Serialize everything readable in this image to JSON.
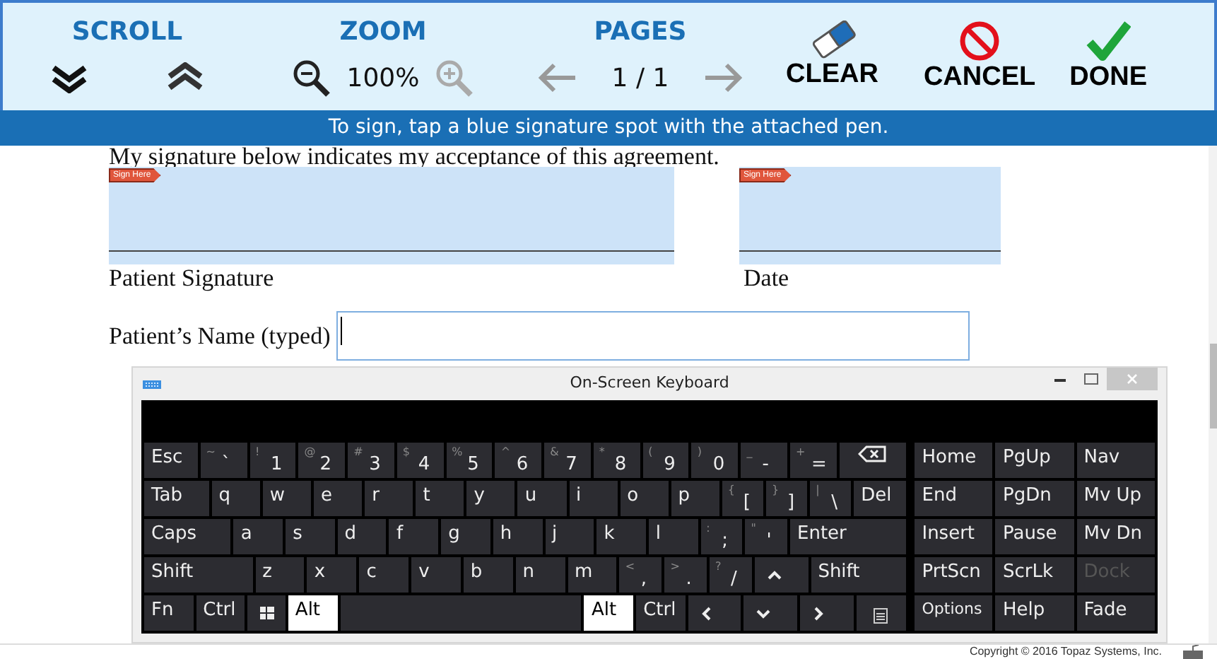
{
  "toolbar": {
    "scroll": {
      "title": "SCROLL"
    },
    "zoom": {
      "title": "ZOOM",
      "level_text": "100%",
      "zoom_out_disabled": false,
      "zoom_in_disabled": true
    },
    "pages": {
      "title": "PAGES",
      "page_text": "1 / 1",
      "prev_disabled": true,
      "next_disabled": true
    },
    "actions": [
      {
        "kind": "clear",
        "label": "CLEAR"
      },
      {
        "kind": "cancel",
        "label": "CANCEL"
      },
      {
        "kind": "done",
        "label": "DONE"
      }
    ]
  },
  "instruction": "To sign, tap a blue signature spot with the attached pen.",
  "document": {
    "agreement_text": "My signature below indicates my acceptance of this agreement.",
    "signature_spots": [
      {
        "tag": "Sign Here",
        "caption": "Patient Signature"
      },
      {
        "tag": "Sign Here",
        "caption": "Date"
      }
    ],
    "name_field": {
      "label": "Patient’s Name (typed)",
      "focused": true
    }
  },
  "keyboard": {
    "title": "On-Screen Keyboard",
    "main_rows": [
      [
        {
          "kind": "text",
          "label": "Esc",
          "pressed": false
        },
        {
          "kind": "dual",
          "shift": "~",
          "label": "`",
          "pressed": false
        },
        {
          "kind": "dual",
          "shift": "!",
          "label": "1",
          "pressed": false
        },
        {
          "kind": "dual",
          "shift": "@",
          "label": "2",
          "pressed": false
        },
        {
          "kind": "dual",
          "shift": "#",
          "label": "3",
          "pressed": false
        },
        {
          "kind": "dual",
          "shift": "$",
          "label": "4",
          "pressed": false
        },
        {
          "kind": "dual",
          "shift": "%",
          "label": "5",
          "pressed": false
        },
        {
          "kind": "dual",
          "shift": "^",
          "label": "6",
          "pressed": false
        },
        {
          "kind": "dual",
          "shift": "&",
          "label": "7",
          "pressed": false
        },
        {
          "kind": "dual",
          "shift": "*",
          "label": "8",
          "pressed": false
        },
        {
          "kind": "dual",
          "shift": "(",
          "label": "9",
          "pressed": false
        },
        {
          "kind": "dual",
          "shift": ")",
          "label": "0",
          "pressed": false
        },
        {
          "kind": "dual",
          "shift": "_",
          "label": "-",
          "pressed": false
        },
        {
          "kind": "dual",
          "shift": "+",
          "label": "=",
          "pressed": false
        },
        {
          "kind": "backspace",
          "pressed": false
        }
      ],
      [
        {
          "kind": "text",
          "label": "Tab",
          "pressed": false
        },
        {
          "kind": "text",
          "label": "q",
          "pressed": false
        },
        {
          "kind": "text",
          "label": "w",
          "pressed": false
        },
        {
          "kind": "text",
          "label": "e",
          "pressed": false
        },
        {
          "kind": "text",
          "label": "r",
          "pressed": false
        },
        {
          "kind": "text",
          "label": "t",
          "pressed": false
        },
        {
          "kind": "text",
          "label": "y",
          "pressed": false
        },
        {
          "kind": "text",
          "label": "u",
          "pressed": false
        },
        {
          "kind": "text",
          "label": "i",
          "pressed": false
        },
        {
          "kind": "text",
          "label": "o",
          "pressed": false
        },
        {
          "kind": "text",
          "label": "p",
          "pressed": false
        },
        {
          "kind": "dual",
          "shift": "{",
          "label": "[",
          "pressed": false
        },
        {
          "kind": "dual",
          "shift": "}",
          "label": "]",
          "pressed": false
        },
        {
          "kind": "dual",
          "shift": "|",
          "label": "\\",
          "pressed": false
        },
        {
          "kind": "text",
          "label": "Del",
          "pressed": false
        }
      ],
      [
        {
          "kind": "text",
          "label": "Caps",
          "pressed": false
        },
        {
          "kind": "text",
          "label": "a",
          "pressed": false
        },
        {
          "kind": "text",
          "label": "s",
          "pressed": false
        },
        {
          "kind": "text",
          "label": "d",
          "pressed": false
        },
        {
          "kind": "text",
          "label": "f",
          "pressed": false
        },
        {
          "kind": "text",
          "label": "g",
          "pressed": false
        },
        {
          "kind": "text",
          "label": "h",
          "pressed": false
        },
        {
          "kind": "text",
          "label": "j",
          "pressed": false
        },
        {
          "kind": "text",
          "label": "k",
          "pressed": false
        },
        {
          "kind": "text",
          "label": "l",
          "pressed": false
        },
        {
          "kind": "dual",
          "shift": ":",
          "label": ";",
          "pressed": false
        },
        {
          "kind": "dual",
          "shift": "\"",
          "label": "'",
          "pressed": false
        },
        {
          "kind": "text",
          "label": "Enter",
          "pressed": false
        }
      ],
      [
        {
          "kind": "text",
          "label": "Shift",
          "pressed": false
        },
        {
          "kind": "text",
          "label": "z",
          "pressed": false
        },
        {
          "kind": "text",
          "label": "x",
          "pressed": false
        },
        {
          "kind": "text",
          "label": "c",
          "pressed": false
        },
        {
          "kind": "text",
          "label": "v",
          "pressed": false
        },
        {
          "kind": "text",
          "label": "b",
          "pressed": false
        },
        {
          "kind": "text",
          "label": "n",
          "pressed": false
        },
        {
          "kind": "text",
          "label": "m",
          "pressed": false
        },
        {
          "kind": "dual",
          "shift": "<",
          "label": ",",
          "pressed": false
        },
        {
          "kind": "dual",
          "shift": ">",
          "label": ".",
          "pressed": false
        },
        {
          "kind": "dual",
          "shift": "?",
          "label": "/",
          "pressed": false
        },
        {
          "kind": "up",
          "pressed": false
        },
        {
          "kind": "text",
          "label": "Shift",
          "pressed": false
        }
      ],
      [
        {
          "kind": "text",
          "label": "Fn",
          "pressed": false
        },
        {
          "kind": "text",
          "label": "Ctrl",
          "pressed": false
        },
        {
          "kind": "windows",
          "pressed": false
        },
        {
          "kind": "text",
          "label": "Alt",
          "pressed": true
        },
        {
          "kind": "space",
          "pressed": false
        },
        {
          "kind": "text",
          "label": "Alt",
          "pressed": true
        },
        {
          "kind": "text",
          "label": "Ctrl",
          "pressed": false
        },
        {
          "kind": "left",
          "pressed": false
        },
        {
          "kind": "down",
          "pressed": false
        },
        {
          "kind": "right",
          "pressed": false
        },
        {
          "kind": "menu",
          "pressed": false
        }
      ]
    ],
    "side_rows": [
      [
        {
          "label": "Home",
          "disabled": false
        },
        {
          "label": "PgUp",
          "disabled": false
        },
        {
          "label": "Nav",
          "disabled": false
        }
      ],
      [
        {
          "label": "End",
          "disabled": false
        },
        {
          "label": "PgDn",
          "disabled": false
        },
        {
          "label": "Mv Up",
          "disabled": false
        }
      ],
      [
        {
          "label": "Insert",
          "disabled": false
        },
        {
          "label": "Pause",
          "disabled": false
        },
        {
          "label": "Mv Dn",
          "disabled": false
        }
      ],
      [
        {
          "label": "PrtScn",
          "disabled": false
        },
        {
          "label": "ScrLk",
          "disabled": false
        },
        {
          "label": "Dock",
          "disabled": true
        }
      ],
      [
        {
          "label": "Options",
          "disabled": false
        },
        {
          "label": "Help",
          "disabled": false
        },
        {
          "label": "Fade",
          "disabled": false
        }
      ]
    ]
  },
  "footer": {
    "copyright": "Copyright © 2016 Topaz Systems, Inc."
  }
}
